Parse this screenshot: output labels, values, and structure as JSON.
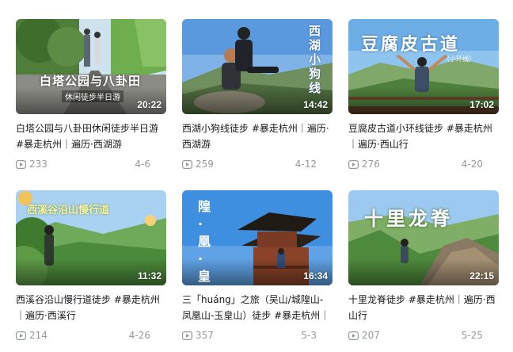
{
  "videos": [
    {
      "thumb_text": "白塔公园与八卦田",
      "thumb_sub": "休闲徒步半日游",
      "duration": "20:22",
      "title": "白塔公园与八卦田休闲徒步半日游 #暴走杭州｜遍历·西湖游",
      "plays": "233",
      "date": "4-6"
    },
    {
      "thumb_text": "西湖小狗线",
      "duration": "14:42",
      "title": "西湖小狗线徒步 #暴走杭州｜遍历·西湖游",
      "plays": "259",
      "date": "4-12"
    },
    {
      "thumb_text": "豆腐皮古道",
      "thumb_sub": "（小环线）",
      "duration": "17:02",
      "title": "豆腐皮古道小环线徒步 #暴走杭州 ｜遍历·西山行",
      "plays": "276",
      "date": "4-20"
    },
    {
      "thumb_text": "西溪谷沿山慢行道",
      "duration": "11:32",
      "title": "西溪谷沿山慢行道徒步 #暴走杭州 ｜遍历·西溪行",
      "plays": "214",
      "date": "4-26"
    },
    {
      "thumb_text": "隍·凰·皇",
      "duration": "16:34",
      "title": "三「huáng」之旅（吴山/城隍山-凤凰山-玉皇山）徒步 #暴走杭州｜",
      "plays": "357",
      "date": "5-3"
    },
    {
      "thumb_text": "十里龙脊",
      "duration": "22:15",
      "title": "十里龙脊徒步 #暴走杭州｜遍历·西山行",
      "plays": "207",
      "date": "5-25"
    }
  ],
  "icons": {
    "plays": "play-count-icon"
  },
  "colors": {
    "title": "#18191c",
    "meta": "#9499a0",
    "background": "#ffffff"
  }
}
